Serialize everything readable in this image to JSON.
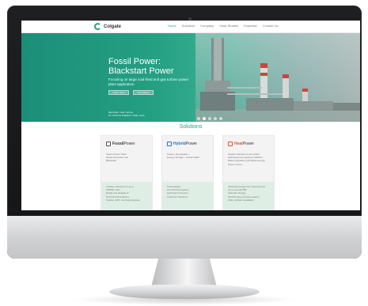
{
  "site": {
    "logo_text": "Colgate",
    "nav": [
      "Home",
      "Solutions",
      "Company",
      "Case Studies",
      "Expertise",
      "Contact Us"
    ]
  },
  "hero": {
    "title_line1": "Fossil Power:",
    "title_line2": "Blackstart Power",
    "subtitle": "Focusing on large coal-fired and gas turbine power plant application",
    "buttons": [
      "Learn more",
      "Get started"
    ],
    "caption_line1": "Blackstart, Gas Turbine",
    "caption_line2": "PT. PAITON ENERGY ONE, JAVA",
    "slide_active": 1,
    "slide_count": 5
  },
  "solutions": {
    "title": "Solutions",
    "cards": [
      {
        "name_prefix": "Fossil",
        "name_suffix": "Power",
        "upper": [
          "Steam Power Plant",
          "Diesel Generator Set",
          "Blackstart"
        ],
        "lower": [
          "Turnkey solutions for up to",
          "350MW units,",
          "Detail cost analysis &",
          "Technical Simulations,",
          "Studies, EPC, and Gas Engines"
        ]
      },
      {
        "name_prefix": "Hybrid",
        "name_suffix": "Power",
        "upper": [
          "Fossil + Renewable +",
          "Energy Storage > 20 kW-1MW"
        ],
        "lower": [
          "Grid-isolated",
          "and Grid-tied system",
          "Hybrid grid structure",
          "Customer Solutions"
        ]
      },
      {
        "name_prefix": "Heat",
        "name_suffix": "Power",
        "upper": [
          "Organic Rankine Cycle (ORC)",
          "Heat Recovery Systems (HRSG)",
          "Boiler Upgrades and Waste Energy",
          "Power Cortex"
        ],
        "lower": [
          "Industrial energy from heat sources",
          "up to several MW,",
          "Absorber Design,",
          "Flexible plug and play system",
          "Fully modular installation"
        ]
      }
    ]
  },
  "colors": {
    "brand_green": "#2aa27b",
    "hero_teal": "#1c8e78",
    "accent_orange": "#e0562b"
  }
}
